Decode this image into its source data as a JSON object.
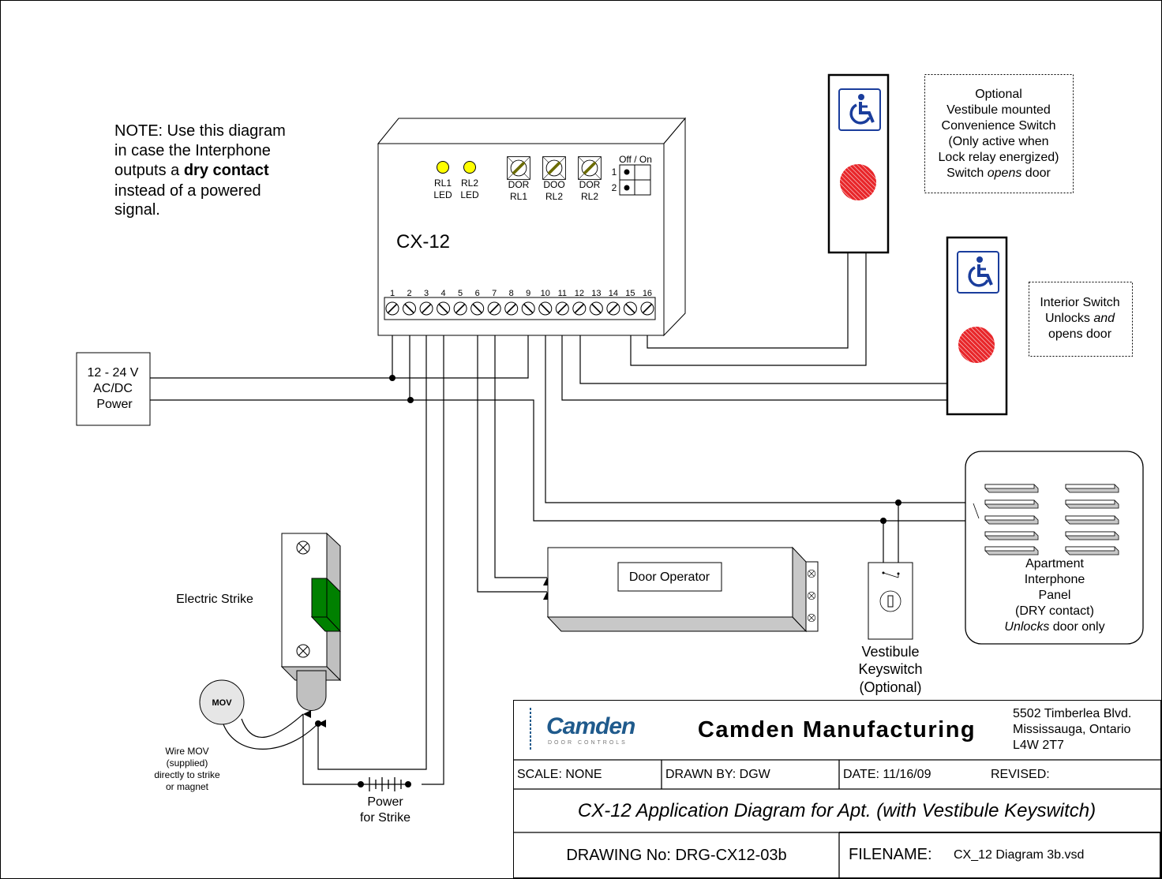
{
  "note": {
    "line1": "NOTE:  Use this diagram",
    "line2": "in case the Interphone",
    "line3a": "outputs a ",
    "line3b": "dry contact",
    "line4": "instead of a powered",
    "line5": "signal."
  },
  "controller": {
    "model": "CX-12",
    "leds": [
      {
        "l1": "RL1",
        "l2": "LED",
        "color": "#ffff00"
      },
      {
        "l1": "RL2",
        "l2": "LED",
        "color": "#ffff00"
      }
    ],
    "pots": [
      {
        "l1": "DOR",
        "l2": "RL1"
      },
      {
        "l1": "DOO",
        "l2": "RL2"
      },
      {
        "l1": "DOR",
        "l2": "RL2"
      }
    ],
    "dip": {
      "label": "Off / On",
      "rows": [
        "1",
        "2"
      ]
    },
    "terminals": [
      "1",
      "2",
      "3",
      "4",
      "5",
      "6",
      "7",
      "8",
      "9",
      "10",
      "11",
      "12",
      "13",
      "14",
      "15",
      "16"
    ]
  },
  "power": {
    "l1": "12 - 24 V",
    "l2": "AC/DC",
    "l3": "Power"
  },
  "optional_switch": {
    "l1": "Optional",
    "l2": "Vestibule mounted",
    "l3": "Convenience Switch",
    "l4": "(Only active when",
    "l5": "Lock relay energized)",
    "l6a": "Switch ",
    "l6b": "opens",
    "l6c": " door"
  },
  "interior_switch": {
    "l1": "Interior Switch",
    "l2a": "Unlocks ",
    "l2b": "and",
    "l3": "opens door"
  },
  "interphone": {
    "l1": "Apartment",
    "l2": "Interphone",
    "l3": "Panel",
    "l4": "(DRY contact)",
    "l5a": "Unlocks",
    "l5b": " door only"
  },
  "keyswitch": {
    "l1": "Vestibule",
    "l2": "Keyswitch",
    "l3": "(Optional)"
  },
  "door_operator": {
    "label": "Door Operator"
  },
  "strike": {
    "label": "Electric Strike",
    "mov": "MOV",
    "mov_note": [
      "Wire MOV",
      "(supplied)",
      "directly to strike",
      "or magnet"
    ]
  },
  "strike_power": {
    "l1": "Power",
    "l2": "for Strike"
  },
  "title_block": {
    "logo": "Camden",
    "logo_sub": "DOOR CONTROLS",
    "company": "Camden Manufacturing",
    "address": [
      "5502 Timberlea Blvd.",
      "Mississauga, Ontario",
      "L4W 2T7"
    ],
    "scale": "SCALE:  NONE",
    "drawn_by": "DRAWN BY: DGW",
    "date": "DATE:  11/16/09",
    "revised": "REVISED:",
    "title": "CX-12 Application Diagram for Apt. (with Vestibule Keyswitch)",
    "drawing_no": "DRAWING No: DRG-CX12-03b",
    "filename_label": "FILENAME:",
    "filename": "CX_12 Diagram 3b.vsd"
  },
  "colors": {
    "led": "#ffff00",
    "button": "#e8262a",
    "accessibility_icon": "#1a3d9c",
    "strike_keeper": "#008000",
    "logo": "#1f5a8c"
  }
}
